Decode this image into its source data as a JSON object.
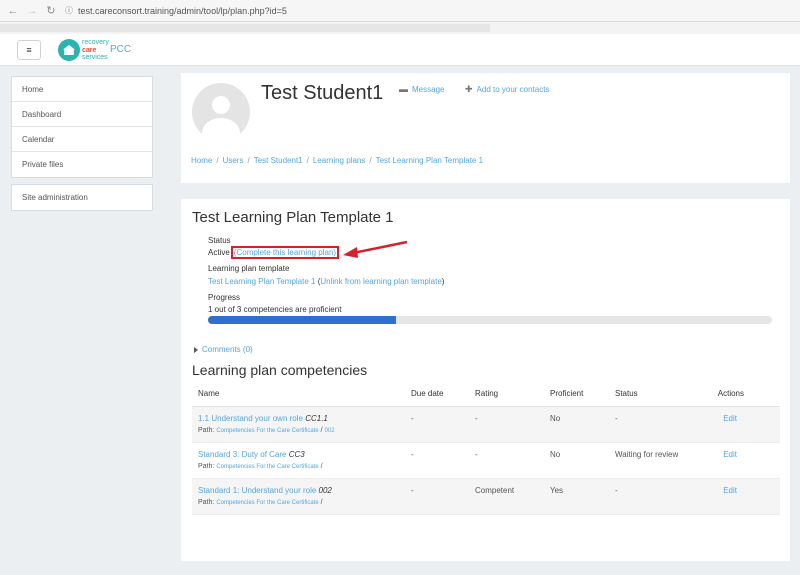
{
  "browser": {
    "back_icon": "arrow-left",
    "forward_icon": "arrow-right",
    "reload_icon": "reload",
    "url": "test.careconsort.training/admin/tool/lp/plan.php?id=5"
  },
  "navbar": {
    "menu_glyph": "≡",
    "logo": {
      "line1": "recovery",
      "line2": "care",
      "line3": "services"
    },
    "site_name": "PCC"
  },
  "sidebar": {
    "items": [
      "Home",
      "Dashboard",
      "Calendar",
      "Private files"
    ],
    "admin": "Site administration"
  },
  "profile": {
    "name": "Test Student1",
    "message_label": "Message",
    "add_contact_label": "Add to your contacts",
    "breadcrumb": [
      "Home",
      "Users",
      "Test Student1",
      "Learning plans",
      "Test Learning Plan Template 1"
    ]
  },
  "plan": {
    "title": "Test Learning Plan Template 1",
    "status_label": "Status",
    "status_value": "Active",
    "complete_link": "(Complete this learning plan)",
    "template_label": "Learning plan template",
    "template_link": "Test Learning Plan Template 1",
    "unlink_open": " (",
    "unlink_link": "Unlink from learning plan template",
    "unlink_close": ")",
    "progress_label": "Progress",
    "progress_text": "1 out of 3 competencies are proficient",
    "progress_fraction": 0.3333,
    "comments": "Comments (0)",
    "colors": {
      "link": "#56a6df",
      "progress": "#2f6fd0",
      "highlight": "#d9202a"
    }
  },
  "competencies": {
    "title": "Learning plan competencies",
    "headers": [
      "Name",
      "Due date",
      "Rating",
      "Proficient",
      "Status",
      "Actions"
    ],
    "path_label": "Path:",
    "rows": [
      {
        "name": "1.1 Understand your own role",
        "code": "CC1.1",
        "path_framework": "Competencies For the Care Certificate",
        "path_sep": " / ",
        "path_parent": "002",
        "due": "-",
        "rating": "-",
        "proficient": "No",
        "status": "-",
        "action": "Edit"
      },
      {
        "name": "Standard 3: Duty of Care",
        "code": "CC3",
        "path_framework": "Competencies For the Care Certificate",
        "path_sep": " /",
        "path_parent": "",
        "due": "-",
        "rating": "-",
        "proficient": "No",
        "status": "Waiting for review",
        "action": "Edit"
      },
      {
        "name": "Standard 1: Understand your role",
        "code": "002",
        "path_framework": "Competencies For the Care Certificate",
        "path_sep": " /",
        "path_parent": "",
        "due": "-",
        "rating": "Competent",
        "proficient": "Yes",
        "status": "-",
        "action": "Edit"
      }
    ]
  }
}
